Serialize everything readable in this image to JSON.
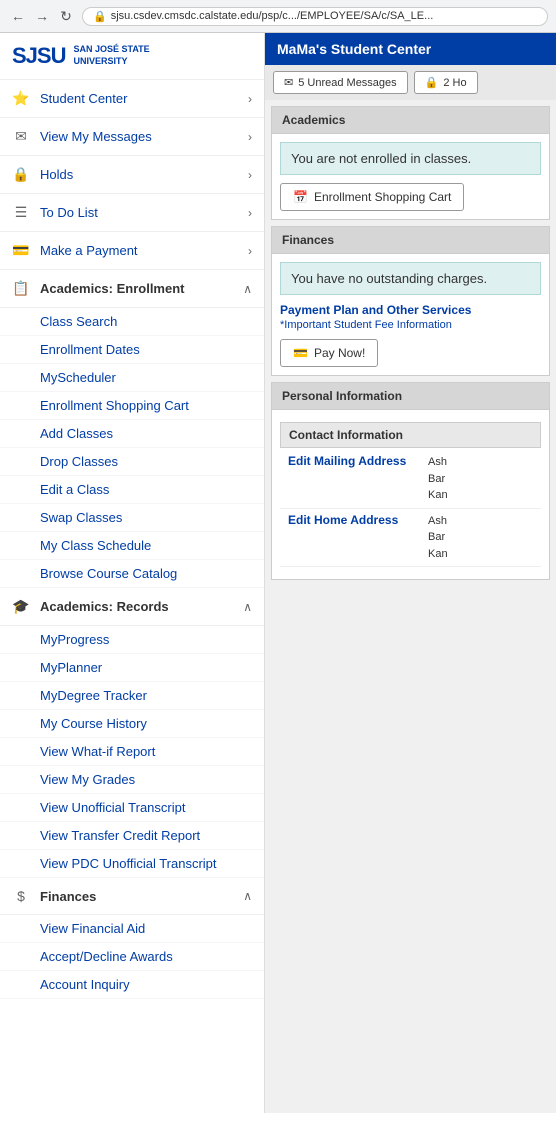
{
  "browser": {
    "url": "sjsu.csdev.cmsdc.calstate.edu/psp/c.../EMPLOYEE/SA/c/SA_LE...",
    "lock_icon": "🔒"
  },
  "sjsu": {
    "logo": "SJSU",
    "name_line1": "SAN JOSÉ STATE",
    "name_line2": "UNIVERSITY"
  },
  "sidebar": {
    "nav_items": [
      {
        "id": "student-center",
        "icon": "⭐",
        "label": "Student Center",
        "has_chevron": true
      },
      {
        "id": "view-messages",
        "icon": "✉",
        "label": "View My Messages",
        "has_chevron": true
      },
      {
        "id": "holds",
        "icon": "🔒",
        "label": "Holds",
        "has_chevron": true
      },
      {
        "id": "to-do-list",
        "icon": "☰",
        "label": "To Do List",
        "has_chevron": true
      },
      {
        "id": "make-payment",
        "icon": "💳",
        "label": "Make a Payment",
        "has_chevron": true
      }
    ],
    "academics_enrollment": {
      "icon": "📋",
      "title": "Academics: Enrollment",
      "subitems": [
        "Class Search",
        "Enrollment Dates",
        "MyScheduler",
        "Enrollment Shopping Cart",
        "Add Classes",
        "Drop Classes",
        "Edit a Class",
        "Swap Classes",
        "My Class Schedule",
        "Browse Course Catalog"
      ]
    },
    "academics_records": {
      "icon": "🎓",
      "title": "Academics: Records",
      "subitems": [
        "MyProgress",
        "MyPlanner",
        "MyDegree Tracker",
        "My Course History",
        "View What-if Report",
        "View My Grades",
        "View Unofficial Transcript",
        "View Transfer Credit Report",
        "View PDC Unofficial Transcript"
      ]
    },
    "finances": {
      "icon": "$",
      "title": "Finances",
      "subitems": [
        "View Financial Aid",
        "Accept/Decline Awards",
        "Account Inquiry"
      ]
    }
  },
  "main": {
    "header": "MaMa's Student Center",
    "unread_messages_btn": "5 Unread Messages",
    "holds_btn": "2 Ho",
    "academics_section": {
      "label": "Academics",
      "not_enrolled_msg": "You are not enrolled in classes.",
      "enrollment_cart_btn": "Enrollment Shopping Cart"
    },
    "finances_section": {
      "label": "Finances",
      "no_charges_msg": "You have no outstanding charges.",
      "payment_plan_link": "Payment Plan and Other Services",
      "fee_info_link": "*Important Student Fee Information",
      "pay_now_btn": "Pay Now!"
    },
    "personal_info": {
      "label": "Personal Information",
      "contact_info": {
        "label": "Contact Information",
        "mailing_address_link": "Edit Mailing Address",
        "mailing_address_info_line1": "Ash",
        "mailing_address_info_line2": "Bar",
        "mailing_address_info_line3": "Kan",
        "home_address_link": "Edit Home Address",
        "home_address_info_line1": "Ash",
        "home_address_info_line2": "Bar",
        "home_address_info_line3": "Kan"
      }
    }
  }
}
